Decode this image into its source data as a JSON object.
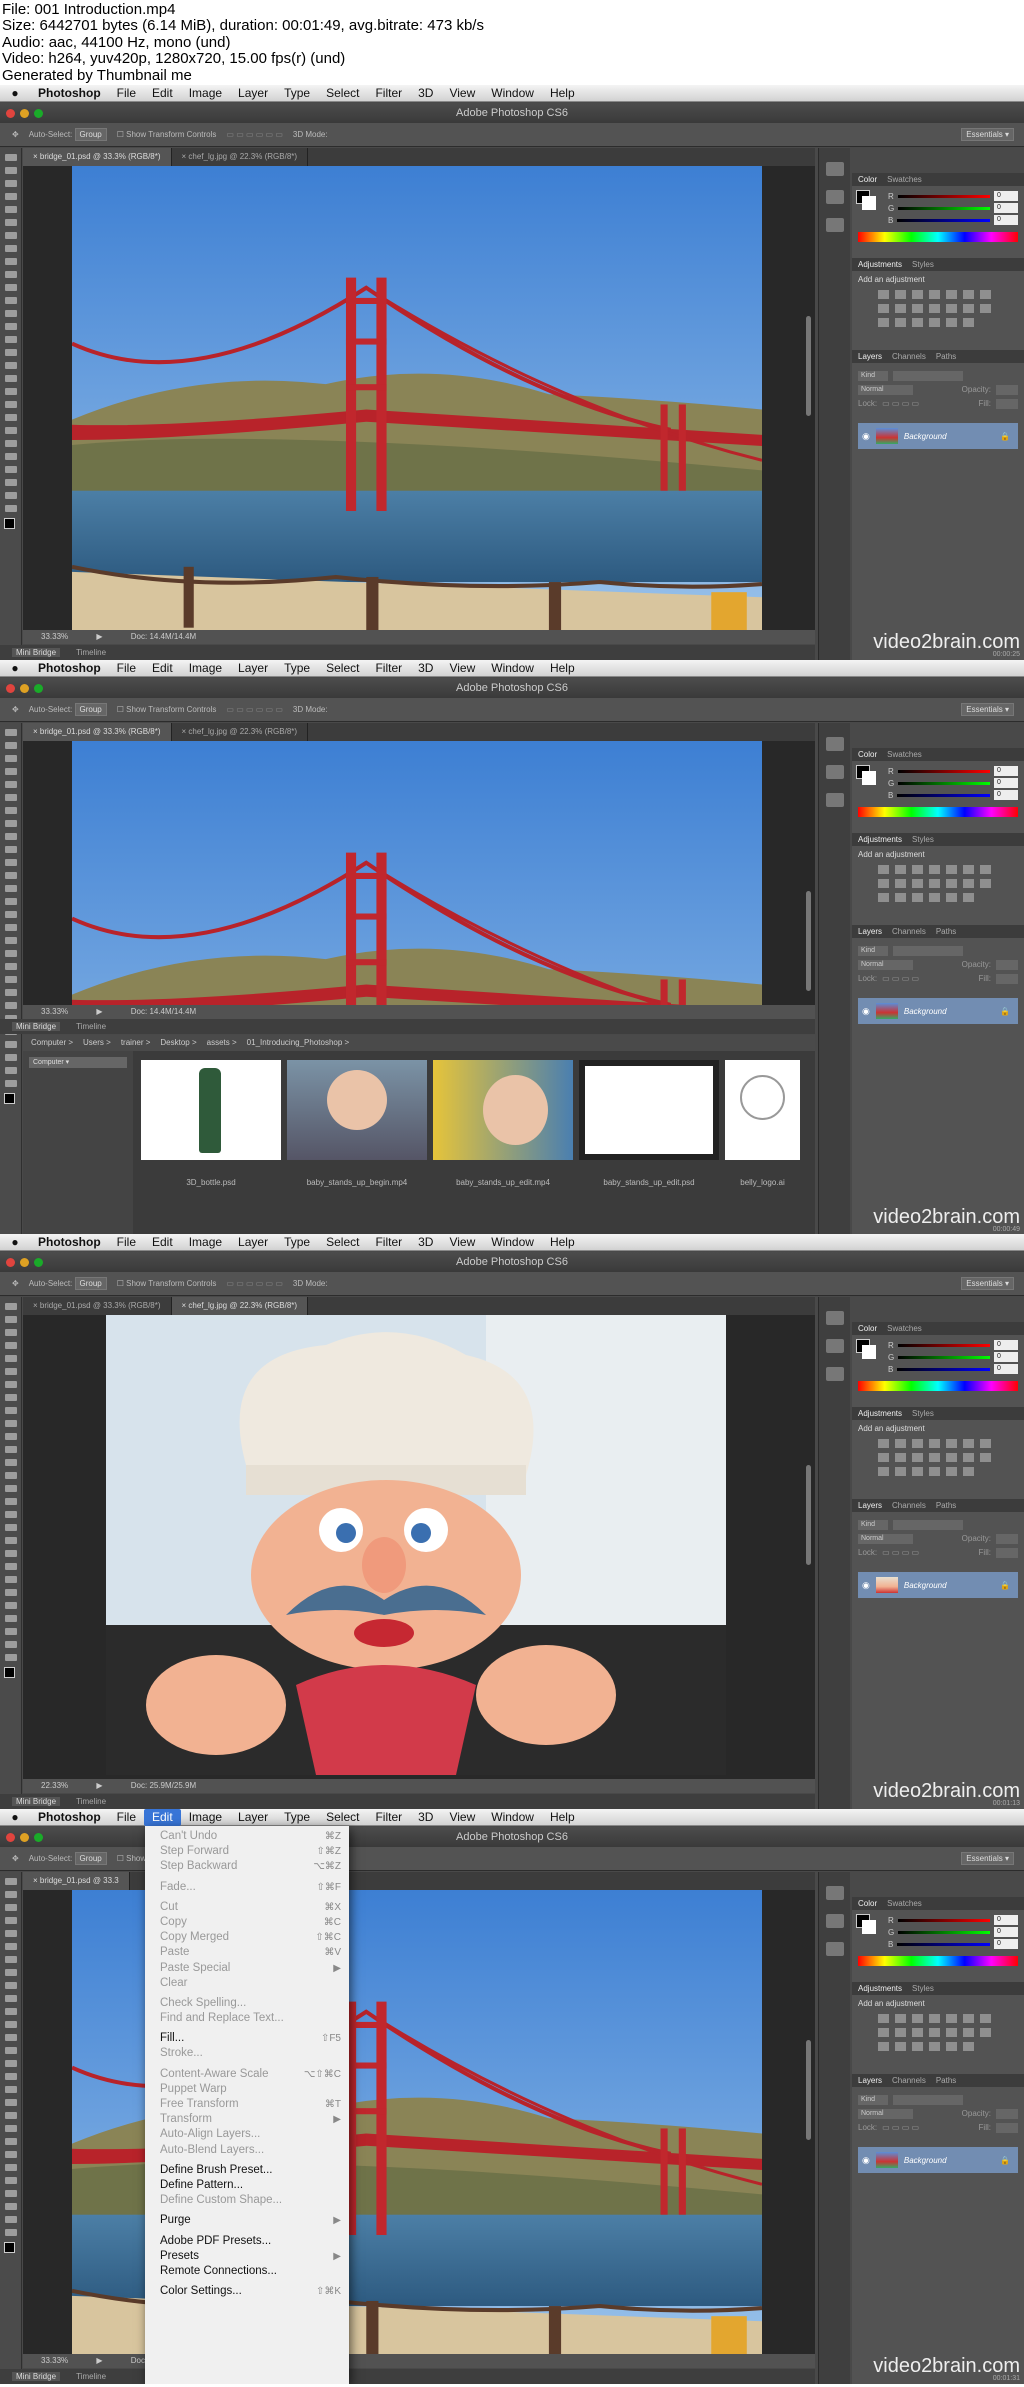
{
  "header": {
    "lines": [
      "File: 001 Introduction.mp4",
      "Size: 6442701 bytes (6.14 MiB), duration: 00:01:49, avg.bitrate: 473 kb/s",
      "Audio: aac, 44100 Hz, mono (und)",
      "Video: h264, yuv420p, 1280x720, 15.00 fps(r) (und)",
      "Generated by Thumbnail me"
    ]
  },
  "menubar": {
    "apple": "",
    "items": [
      "Photoshop",
      "File",
      "Edit",
      "Image",
      "Layer",
      "Type",
      "Select",
      "Filter",
      "3D",
      "View",
      "Window",
      "Help"
    ]
  },
  "window_title": "Adobe Photoshop CS6",
  "options": {
    "auto_select": "Auto-Select:",
    "group": "Group",
    "show_transform": "Show Transform Controls",
    "mode_3d": "3D Mode:",
    "workspace": "Essentials"
  },
  "frames": [
    {
      "tabs": [
        "bridge_01.psd @ 33.3% (RGB/8*)",
        "chef_lg.jpg @ 22.3% (RGB/8*)"
      ],
      "active_tab": 0,
      "zoom": "33.33%",
      "doc": "Doc: 14.4M/14.4M"
    },
    {
      "tabs": [
        "bridge_01.psd @ 33.3% (RGB/8*)",
        "chef_lg.jpg @ 22.3% (RGB/8*)"
      ],
      "active_tab": 0,
      "zoom": "33.33%",
      "doc": "Doc: 14.4M/14.4M"
    },
    {
      "tabs": [
        "bridge_01.psd @ 33.3% (RGB/8*)",
        "chef_lg.jpg @ 22.3% (RGB/8*)"
      ],
      "active_tab": 1,
      "zoom": "22.33%",
      "doc": "Doc: 25.9M/25.9M"
    },
    {
      "tabs": [
        "bridge_01.psd @ 33.3"
      ],
      "active_tab": 0,
      "zoom": "33.33%",
      "doc": "Doc: 14.4M/14.4M"
    }
  ],
  "bottom_tabs": [
    "Mini Bridge",
    "Timeline"
  ],
  "panels": {
    "color_tabs": [
      "Color",
      "Swatches"
    ],
    "rgb": [
      "R",
      "G",
      "B"
    ],
    "rgb_values": [
      "0",
      "0",
      "0"
    ],
    "adjust_tabs": [
      "Adjustments",
      "Styles"
    ],
    "adjust_hint": "Add an adjustment",
    "layers_tabs": [
      "Layers",
      "Channels",
      "Paths"
    ],
    "kind": "Kind",
    "blend": "Normal",
    "opacity": "Opacity:",
    "lock": "Lock:",
    "fill": "Fill:",
    "layer_name": "Background"
  },
  "minibridge": {
    "path": [
      "Computer",
      "Users",
      "trainer",
      "Desktop",
      "assets",
      "01_Introducing_Photoshop"
    ],
    "source": "Computer",
    "files": [
      "3D_bottle.psd",
      "baby_stands_up_begin.mp4",
      "baby_stands_up_edit.mp4",
      "baby_stands_up_edit.psd",
      "belly_logo.ai"
    ]
  },
  "edit_menu": [
    {
      "label": "Can't Undo",
      "sc": "⌘Z",
      "dis": true
    },
    {
      "label": "Step Forward",
      "sc": "⇧⌘Z",
      "dis": true
    },
    {
      "label": "Step Backward",
      "sc": "⌥⌘Z",
      "dis": true
    },
    {
      "sep": true
    },
    {
      "label": "Fade...",
      "sc": "⇧⌘F",
      "dis": true
    },
    {
      "sep": true
    },
    {
      "label": "Cut",
      "sc": "⌘X",
      "dis": true
    },
    {
      "label": "Copy",
      "sc": "⌘C",
      "dis": true
    },
    {
      "label": "Copy Merged",
      "sc": "⇧⌘C",
      "dis": true
    },
    {
      "label": "Paste",
      "sc": "⌘V",
      "dis": true
    },
    {
      "label": "Paste Special",
      "sc": "▶",
      "dis": true
    },
    {
      "label": "Clear",
      "sc": "",
      "dis": true
    },
    {
      "sep": true
    },
    {
      "label": "Check Spelling...",
      "sc": "",
      "dis": true
    },
    {
      "label": "Find and Replace Text...",
      "sc": "",
      "dis": true
    },
    {
      "sep": true
    },
    {
      "label": "Fill...",
      "sc": "⇧F5",
      "dis": false
    },
    {
      "label": "Stroke...",
      "sc": "",
      "dis": true
    },
    {
      "sep": true
    },
    {
      "label": "Content-Aware Scale",
      "sc": "⌥⇧⌘C",
      "dis": true
    },
    {
      "label": "Puppet Warp",
      "sc": "",
      "dis": true
    },
    {
      "label": "Free Transform",
      "sc": "⌘T",
      "dis": true
    },
    {
      "label": "Transform",
      "sc": "▶",
      "dis": true
    },
    {
      "label": "Auto-Align Layers...",
      "sc": "",
      "dis": true
    },
    {
      "label": "Auto-Blend Layers...",
      "sc": "",
      "dis": true
    },
    {
      "sep": true
    },
    {
      "label": "Define Brush Preset...",
      "sc": "",
      "dis": false
    },
    {
      "label": "Define Pattern...",
      "sc": "",
      "dis": false
    },
    {
      "label": "Define Custom Shape...",
      "sc": "",
      "dis": true
    },
    {
      "sep": true
    },
    {
      "label": "Purge",
      "sc": "▶",
      "dis": false
    },
    {
      "sep": true
    },
    {
      "label": "Adobe PDF Presets...",
      "sc": "",
      "dis": false
    },
    {
      "label": "Presets",
      "sc": "▶",
      "dis": false
    },
    {
      "label": "Remote Connections...",
      "sc": "",
      "dis": false
    },
    {
      "sep": true
    },
    {
      "label": "Color Settings...",
      "sc": "⇧⌘K",
      "dis": false
    }
  ],
  "watermark": "video2brain.com",
  "timestamps": [
    "00:00:25",
    "00:00:49",
    "00:01:13",
    "00:01:31"
  ]
}
